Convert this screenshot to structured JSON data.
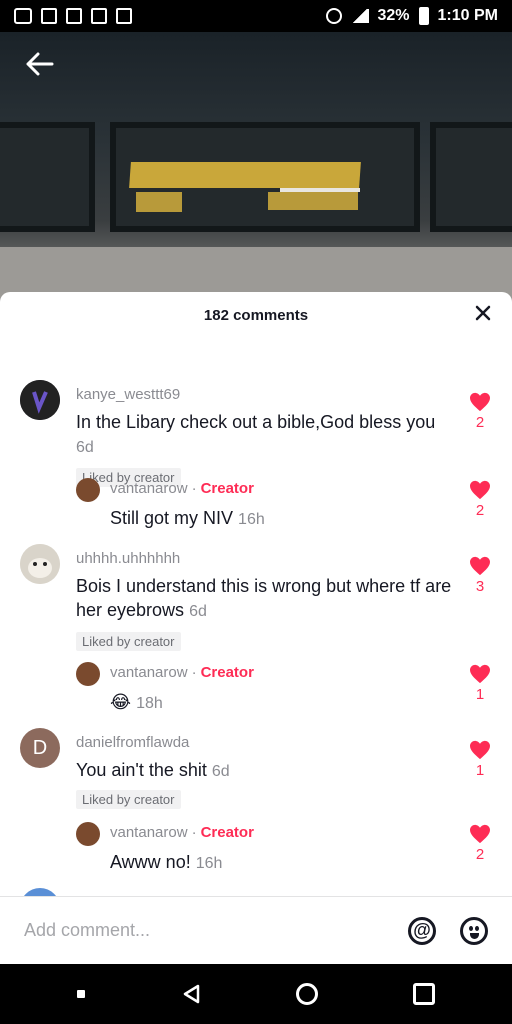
{
  "status_bar": {
    "battery": "32%",
    "time": "1:10 PM"
  },
  "sheet": {
    "title": "182 comments"
  },
  "comments": [
    {
      "username": "kanye_westtt69",
      "text": "In the Libary check out a bible,God bless you",
      "time": "6d",
      "badge": "Liked by creator",
      "likes": "2"
    },
    {
      "username": "vantanarow",
      "tag": "Creator",
      "text": "Still got my NIV",
      "time": "16h",
      "likes": "2"
    },
    {
      "username": "uhhhh.uhhhhhh",
      "text": "Bois I understand this is wrong but where tf are her eyebrows",
      "time": "6d",
      "badge": "Liked by creator",
      "likes": "3"
    },
    {
      "username": "vantanarow",
      "tag": "Creator",
      "text": "😂",
      "time": "18h",
      "likes": "1"
    },
    {
      "username": "danielfromflawda",
      "avatar_letter": "D",
      "text": "You ain't the shit",
      "time": "6d",
      "badge": "Liked by creator",
      "likes": "1"
    },
    {
      "username": "vantanarow",
      "tag": "Creator",
      "text": "Awww no!",
      "time": "16h",
      "likes": "2"
    }
  ],
  "input": {
    "placeholder": "Add comment..."
  },
  "icons": {
    "back": "arrow-left-icon",
    "close": "close-icon",
    "like": "heart-icon",
    "mention": "at-icon",
    "emoji": "emoji-icon"
  },
  "colors": {
    "accent": "#fe2c55",
    "text": "#161823",
    "muted": "#8a8b91"
  }
}
